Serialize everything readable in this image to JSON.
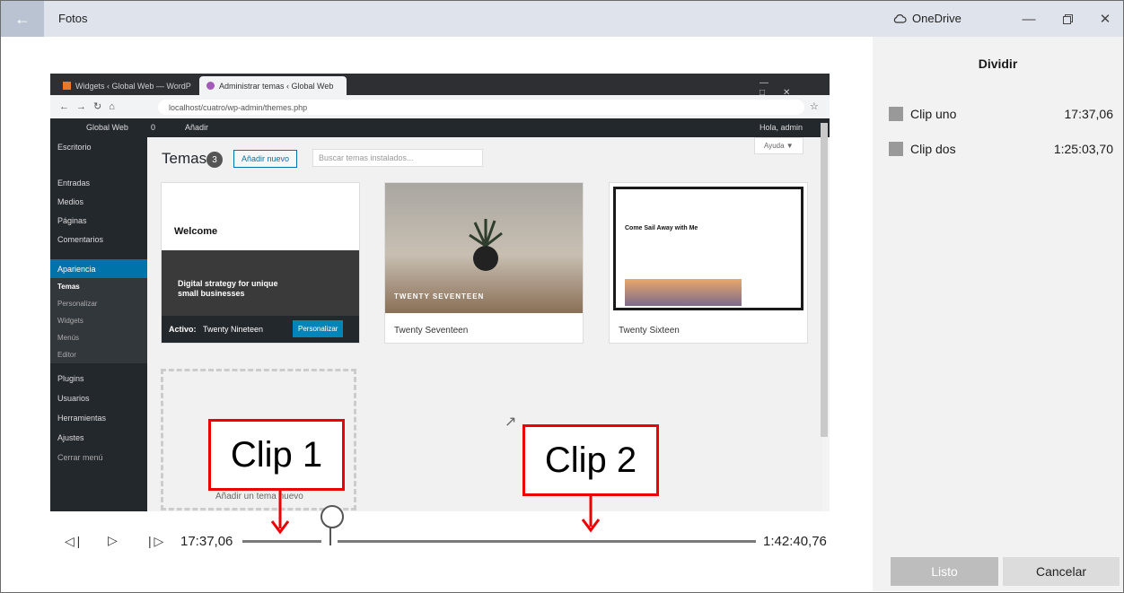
{
  "window": {
    "title": "Fotos",
    "cloud_label": "OneDrive"
  },
  "side_panel": {
    "title": "Dividir",
    "clips": [
      {
        "name": "Clip uno",
        "time": "17:37,06"
      },
      {
        "name": "Clip dos",
        "time": "1:25:03,70"
      }
    ],
    "done_label": "Listo",
    "cancel_label": "Cancelar"
  },
  "video_frame": {
    "tabs": [
      "Widgets ‹ Global Web — WordP",
      "Administrar temas ‹ Global Web"
    ],
    "url": "localhost/cuatro/wp-admin/themes.php",
    "wp_adminbar": {
      "site": "Global Web",
      "comments": "0",
      "add": "Añadir",
      "greeting": "Hola, admin"
    },
    "menu": [
      {
        "label": "Escritorio"
      },
      {
        "label": "Entradas"
      },
      {
        "label": "Medios"
      },
      {
        "label": "Páginas"
      },
      {
        "label": "Comentarios"
      },
      {
        "label": "Apariencia"
      },
      {
        "label": "Temas"
      },
      {
        "label": "Personalizar"
      },
      {
        "label": "Widgets"
      },
      {
        "label": "Menús"
      },
      {
        "label": "Editor"
      },
      {
        "label": "Plugins"
      },
      {
        "label": "Usuarios"
      },
      {
        "label": "Herramientas"
      },
      {
        "label": "Ajustes"
      },
      {
        "label": "Cerrar menú"
      }
    ],
    "page_title": "Temas",
    "theme_count": "3",
    "add_new": "Añadir nuevo",
    "search_placeholder": "Buscar temas instalados...",
    "help": "Ayuda ▼",
    "themes": [
      {
        "welcome": "Welcome",
        "tagline": "Digital strategy for unique small businesses",
        "active_prefix": "Activo:",
        "name": "Twenty Nineteen",
        "customize": "Personalizar"
      },
      {
        "overlay": "TWENTY SEVENTEEN",
        "name": "Twenty Seventeen"
      },
      {
        "headline": "Come Sail Away with Me",
        "name": "Twenty Sixteen"
      }
    ],
    "add_theme": "Añadir un tema nuevo"
  },
  "annotations": {
    "clip1": "Clip 1",
    "clip2": "Clip 2"
  },
  "playback": {
    "current_time": "17:37,06",
    "total_time": "1:42:40,76"
  }
}
